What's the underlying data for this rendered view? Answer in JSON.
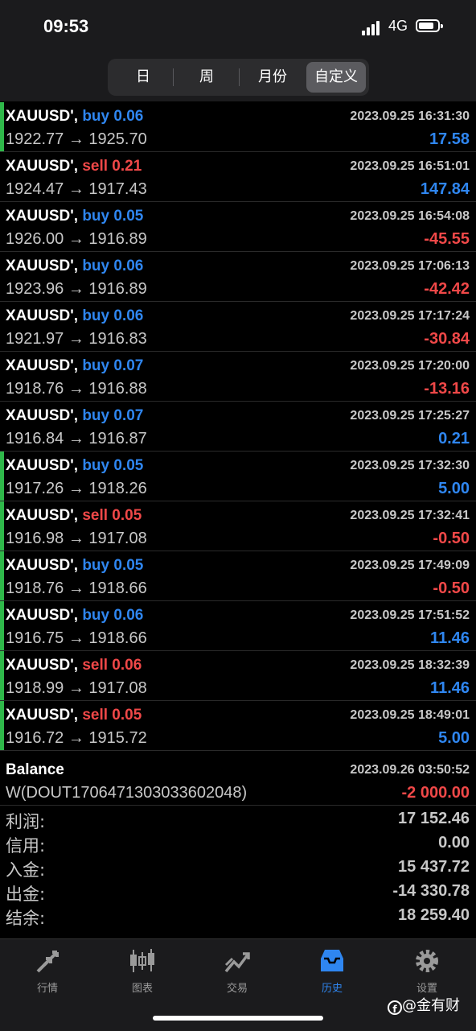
{
  "status": {
    "time": "09:53",
    "network": "4G"
  },
  "segments": [
    {
      "label": "日",
      "selected": false
    },
    {
      "label": "周",
      "selected": false
    },
    {
      "label": "月份",
      "selected": false
    },
    {
      "label": "自定义",
      "selected": true
    }
  ],
  "trades": [
    {
      "symbol": "XAUUSD',",
      "side": "buy",
      "volume": "0.06",
      "open": "1922.77",
      "close": "1925.70",
      "time": "2023.09.25 16:31:30",
      "profit": "17.58",
      "profit_sign": "pos",
      "marker": "#2fb84a"
    },
    {
      "symbol": "XAUUSD',",
      "side": "sell",
      "volume": "0.21",
      "open": "1924.47",
      "close": "1917.43",
      "time": "2023.09.25 16:51:01",
      "profit": "147.84",
      "profit_sign": "pos",
      "marker": ""
    },
    {
      "symbol": "XAUUSD',",
      "side": "buy",
      "volume": "0.05",
      "open": "1926.00",
      "close": "1916.89",
      "time": "2023.09.25 16:54:08",
      "profit": "-45.55",
      "profit_sign": "neg",
      "marker": ""
    },
    {
      "symbol": "XAUUSD',",
      "side": "buy",
      "volume": "0.06",
      "open": "1923.96",
      "close": "1916.89",
      "time": "2023.09.25 17:06:13",
      "profit": "-42.42",
      "profit_sign": "neg",
      "marker": ""
    },
    {
      "symbol": "XAUUSD',",
      "side": "buy",
      "volume": "0.06",
      "open": "1921.97",
      "close": "1916.83",
      "time": "2023.09.25 17:17:24",
      "profit": "-30.84",
      "profit_sign": "neg",
      "marker": ""
    },
    {
      "symbol": "XAUUSD',",
      "side": "buy",
      "volume": "0.07",
      "open": "1918.76",
      "close": "1916.88",
      "time": "2023.09.25 17:20:00",
      "profit": "-13.16",
      "profit_sign": "neg",
      "marker": ""
    },
    {
      "symbol": "XAUUSD',",
      "side": "buy",
      "volume": "0.07",
      "open": "1916.84",
      "close": "1916.87",
      "time": "2023.09.25 17:25:27",
      "profit": "0.21",
      "profit_sign": "pos",
      "marker": ""
    },
    {
      "symbol": "XAUUSD',",
      "side": "buy",
      "volume": "0.05",
      "open": "1917.26",
      "close": "1918.26",
      "time": "2023.09.25 17:32:30",
      "profit": "5.00",
      "profit_sign": "pos",
      "marker": "#2fb84a"
    },
    {
      "symbol": "XAUUSD',",
      "side": "sell",
      "volume": "0.05",
      "open": "1916.98",
      "close": "1917.08",
      "time": "2023.09.25 17:32:41",
      "profit": "-0.50",
      "profit_sign": "neg",
      "marker": "#2fb84a"
    },
    {
      "symbol": "XAUUSD',",
      "side": "buy",
      "volume": "0.05",
      "open": "1918.76",
      "close": "1918.66",
      "time": "2023.09.25 17:49:09",
      "profit": "-0.50",
      "profit_sign": "neg",
      "marker": "#2fb84a"
    },
    {
      "symbol": "XAUUSD',",
      "side": "buy",
      "volume": "0.06",
      "open": "1916.75",
      "close": "1918.66",
      "time": "2023.09.25 17:51:52",
      "profit": "11.46",
      "profit_sign": "pos",
      "marker": "#2fb84a"
    },
    {
      "symbol": "XAUUSD',",
      "side": "sell",
      "volume": "0.06",
      "open": "1918.99",
      "close": "1917.08",
      "time": "2023.09.25 18:32:39",
      "profit": "11.46",
      "profit_sign": "pos",
      "marker": "#2fb84a"
    },
    {
      "symbol": "XAUUSD',",
      "side": "sell",
      "volume": "0.05",
      "open": "1916.72",
      "close": "1915.72",
      "time": "2023.09.25 18:49:01",
      "profit": "5.00",
      "profit_sign": "pos",
      "marker": "#2fb84a"
    }
  ],
  "balance_entry": {
    "title": "Balance",
    "comment": "W(DOUT1706471303033602048)",
    "time": "2023.09.26 03:50:52",
    "amount": "-2 000.00"
  },
  "summary": [
    {
      "label": "利润:",
      "value": "17 152.46"
    },
    {
      "label": "信用:",
      "value": "0.00"
    },
    {
      "label": "入金:",
      "value": "15 437.72"
    },
    {
      "label": "出金:",
      "value": "-14 330.78"
    },
    {
      "label": "结余:",
      "value": "18 259.40"
    }
  ],
  "tabs": [
    {
      "label": "行情",
      "icon": "quotes-arrows-icon",
      "active": false
    },
    {
      "label": "图表",
      "icon": "candlestick-chart-icon",
      "active": false
    },
    {
      "label": "交易",
      "icon": "trade-trend-icon",
      "active": false
    },
    {
      "label": "历史",
      "icon": "history-inbox-icon",
      "active": true
    },
    {
      "label": "设置",
      "icon": "gear-icon",
      "active": false
    }
  ],
  "watermark": {
    "text": "@金有财",
    "icon": "f-logo"
  },
  "colors": {
    "buy": "#2f86f0",
    "sell": "#f04848",
    "marker": "#2fb84a",
    "active_tab": "#2f86f0"
  }
}
